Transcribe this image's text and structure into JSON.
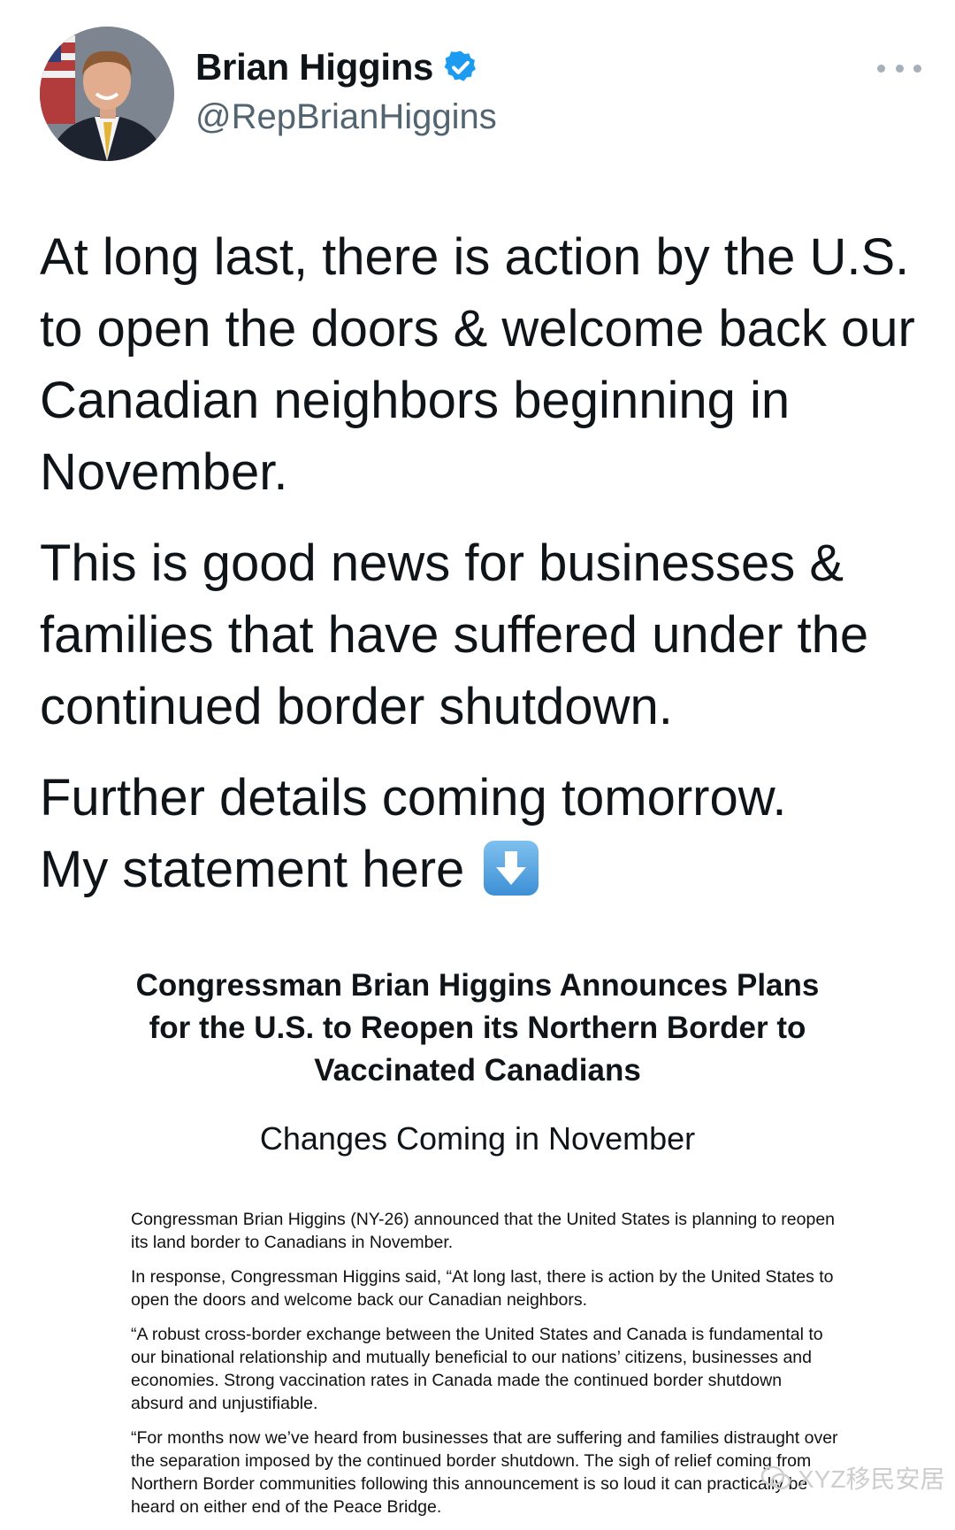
{
  "author": {
    "display_name": "Brian Higgins",
    "handle": "@RepBrianHiggins",
    "verified": true,
    "avatar_icon": "avatar-photo"
  },
  "menu": {
    "icon": "more-dots-icon"
  },
  "tweet": {
    "paragraphs": [
      "At long last, there is action by the U.S. to open the doors & welcome back our Canadian neighbors beginning in November.",
      "This is good news for businesses & families that have suffered under the continued border shutdown.",
      "Further details coming tomorrow."
    ],
    "last_line": "My statement here",
    "emoji": "down-arrow-emoji"
  },
  "statement": {
    "title": "Congressman Brian Higgins Announces Plans for the U.S. to Reopen its Northern Border to Vaccinated Canadians",
    "subtitle": "Changes Coming in November",
    "paragraphs": [
      "Congressman Brian Higgins (NY-26) announced that the United States is planning to reopen its land border to Canadians in November.",
      "In response, Congressman Higgins said, “At long last, there is action by the United States to open the doors and welcome back our Canadian neighbors.",
      "“A robust cross-border exchange between the United States and Canada is fundamental to our binational relationship and mutually beneficial to our nations’ citizens, businesses and economies. Strong vaccination rates in Canada made the continued border shutdown absurd and unjustifiable.",
      "“For months now we’ve heard from businesses that are suffering and families distraught over the separation imposed by the continued border shutdown. The sigh of relief coming from Northern Border communities following this announcement is so loud it can practically be heard on either end of the Peace Bridge."
    ]
  },
  "watermark": {
    "text": "XYZ移民安居"
  },
  "colors": {
    "verified": "#1d9bf0",
    "handle": "#536471",
    "text": "#0f1419"
  }
}
